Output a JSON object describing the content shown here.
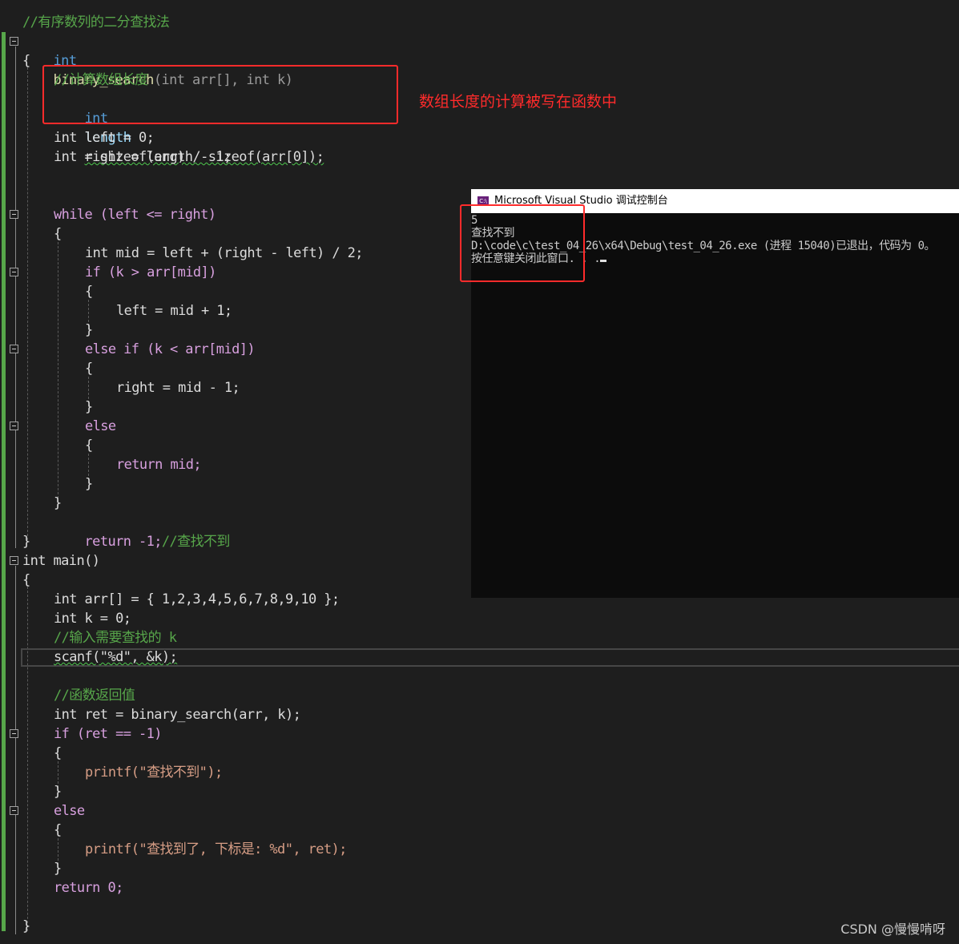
{
  "annotation": {
    "text": "数组长度的计算被写在函数中"
  },
  "code": {
    "comment_title": "//有序数列的二分查找法",
    "fn_sig": {
      "ret_type": "int",
      "name": "binary_search",
      "params": "(int arr[], int k)"
    },
    "comment_len": "//计算数组长度",
    "len_stmt": {
      "type": "int",
      "name": "length",
      "rhs": "= sizeof(arr) / sizeof(arr[0]);"
    },
    "left_decl": "int left = 0;",
    "right_decl": "int right = length - 1;",
    "while_line": "while (left <= right)",
    "mid_line": "int mid = left + (right - left) / 2;",
    "if_line": "if (k > arr[mid])",
    "left_assign": "left = mid + 1;",
    "elseif_line": "else if (k < arr[mid])",
    "right_assign": "right = mid - 1;",
    "else_line": "else",
    "return_mid": "return mid;",
    "return_neg": "return -1;",
    "return_neg_comment": "//查找不到",
    "main_sig": "int main()",
    "arr_decl": "int arr[] = { 1,2,3,4,5,6,7,8,9,10 };",
    "k_decl": "int k = 0;",
    "comment_input": "//输入需要查找的 k",
    "scanf_line": "scanf(\"%d\", &k);",
    "comment_ret": "//函数返回值",
    "ret_decl": "int ret = binary_search(arr, k);",
    "if_ret": "if (ret == -1)",
    "printf_notfound": "printf(\"查找不到\");",
    "else_main": "else",
    "printf_found": "printf(\"查找到了, 下标是: %d\", ret);",
    "return_zero": "return 0;"
  },
  "console": {
    "title": "Microsoft Visual Studio 调试控制台",
    "icon": "C:\\",
    "lines": [
      "5",
      "查找不到",
      "D:\\code\\c\\test_04_26\\x64\\Debug\\test_04_26.exe (进程 15040)已退出，代码为 0。",
      "按任意键关闭此窗口. . ."
    ]
  },
  "watermark": "CSDN @慢慢啃呀"
}
